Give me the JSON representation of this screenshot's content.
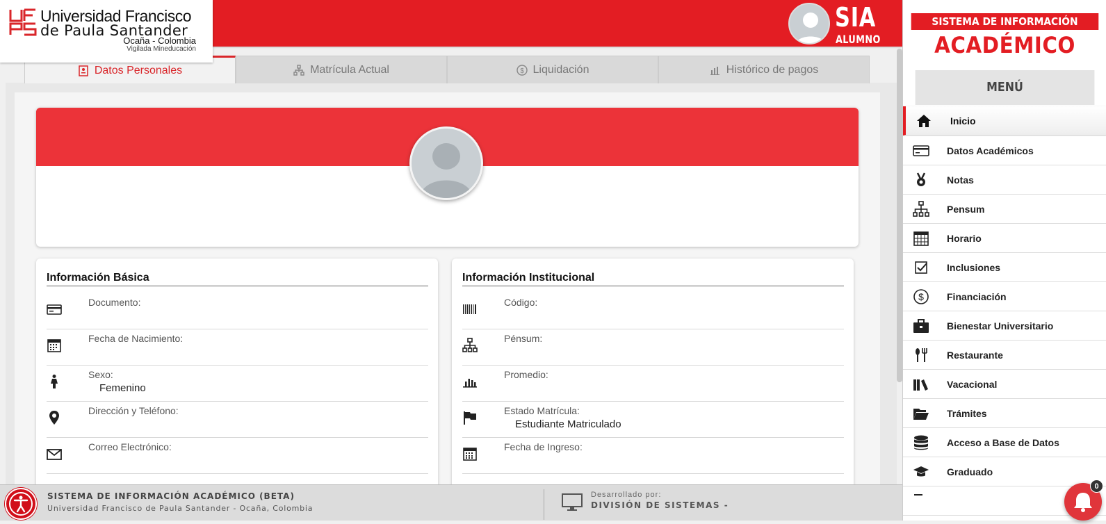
{
  "header": {
    "university_line1": "Universidad Francisco",
    "university_line2": "de Paula Santander",
    "location": "Ocaña - Colombia",
    "vigilada": "Vigilada Mineducación",
    "sia": "SIA",
    "role": "ALUMNO"
  },
  "tabs": [
    {
      "label": "Datos Personales",
      "icon": "id-card-icon",
      "active": true
    },
    {
      "label": "Matrícula Actual",
      "icon": "org-chart-icon",
      "active": false
    },
    {
      "label": "Liquidación",
      "icon": "dollar-circle-icon",
      "active": false
    },
    {
      "label": "Histórico de pagos",
      "icon": "bar-chart-icon",
      "active": false
    }
  ],
  "basic_info": {
    "title": "Información Básica",
    "rows": [
      {
        "label": "Documento:",
        "value": "",
        "icon": "id-card-icon"
      },
      {
        "label": "Fecha de Nacimiento:",
        "value": "",
        "icon": "calendar-icon"
      },
      {
        "label": "Sexo:",
        "value": "Femenino",
        "icon": "female-icon"
      },
      {
        "label": "Dirección y Teléfono:",
        "value": "",
        "icon": "map-pin-icon"
      },
      {
        "label": "Correo Electrónico:",
        "value": "",
        "icon": "envelope-icon"
      }
    ]
  },
  "institutional_info": {
    "title": "Información Institucional",
    "rows": [
      {
        "label": "Código:",
        "value": "",
        "icon": "barcode-icon"
      },
      {
        "label": "Pénsum:",
        "value": "",
        "icon": "org-chart-icon"
      },
      {
        "label": "Promedio:",
        "value": "",
        "icon": "bar-chart-icon"
      },
      {
        "label": "Estado Matrícula:",
        "value": "Estudiante Matriculado",
        "icon": "flag-icon"
      },
      {
        "label": "Fecha de Ingreso:",
        "value": "",
        "icon": "calendar-icon"
      }
    ]
  },
  "sidebar": {
    "system_label": "SISTEMA DE INFORMACIÓN",
    "system_big": "ACADÉMICO",
    "menu_title": "MENÚ",
    "items": [
      {
        "label": "Inicio",
        "icon": "home-icon",
        "active": true
      },
      {
        "label": "Datos Académicos",
        "icon": "card-icon",
        "active": false
      },
      {
        "label": "Notas",
        "icon": "medal-icon",
        "active": false
      },
      {
        "label": "Pensum",
        "icon": "org-chart-icon",
        "active": false
      },
      {
        "label": "Horario",
        "icon": "calendar-icon",
        "active": false
      },
      {
        "label": "Inclusiones",
        "icon": "checkbox-icon",
        "active": false
      },
      {
        "label": "Financiación",
        "icon": "dollar-circle-icon",
        "active": false
      },
      {
        "label": "Bienestar Universitario",
        "icon": "briefcase-icon",
        "active": false
      },
      {
        "label": "Restaurante",
        "icon": "cutlery-icon",
        "active": false
      },
      {
        "label": "Vacacional",
        "icon": "books-icon",
        "active": false
      },
      {
        "label": "Trámites",
        "icon": "folder-open-icon",
        "active": false
      },
      {
        "label": "Acceso a Base de Datos",
        "icon": "database-icon",
        "active": false
      },
      {
        "label": "Graduado",
        "icon": "graduation-cap-icon",
        "active": false
      }
    ]
  },
  "footer": {
    "title": "SISTEMA DE INFORMACIÓN ACADÉMICO (BETA)",
    "subtitle": "Universidad Francisco de Paula Santander - Ocaña, Colombia",
    "dev_label": "Desarrollado por:",
    "dev_name": "DIVISIÓN DE SISTEMAS -"
  },
  "notifications": {
    "count": "0"
  },
  "colors": {
    "brand_red": "#e31d23",
    "banner_red": "#ec3339"
  }
}
